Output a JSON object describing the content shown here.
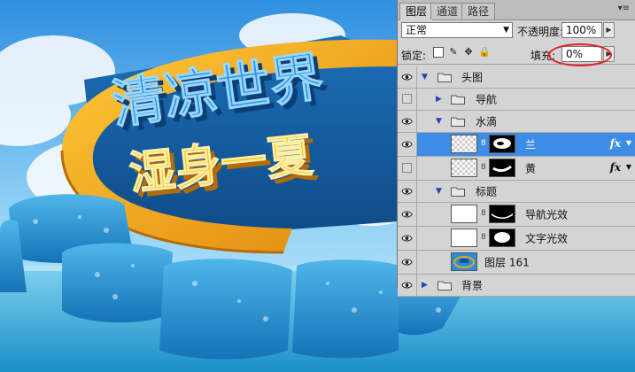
{
  "artwork": {
    "headline_1": "清凉世界",
    "headline_2": "湿身一夏",
    "colors": {
      "sky_top": "#2f8fe0",
      "sky_bottom": "#bfe6fb",
      "sea": "#2aa6d8",
      "title_blue": "#1f7fd0",
      "title_yellow": "#f5b51d",
      "ring_orange": "#f0a21a"
    }
  },
  "panel": {
    "tabs": [
      "图层",
      "通道",
      "路径"
    ],
    "blend_mode": "正常",
    "opacity_label": "不透明度:",
    "opacity_value": "100%",
    "lock_label": "锁定:",
    "fill_label": "填充:",
    "fill_value": "0%",
    "highlight_color": "#e02020"
  },
  "layers": [
    {
      "name": "头图",
      "kind": "group",
      "expanded": true,
      "visible": true
    },
    {
      "name": "导航",
      "kind": "group",
      "expanded": false,
      "visible": false
    },
    {
      "name": "水滴",
      "kind": "group",
      "expanded": true,
      "visible": true
    },
    {
      "name": "兰",
      "kind": "layer",
      "visible": true,
      "selected": true,
      "fx": "fx"
    },
    {
      "name": "黄",
      "kind": "layer",
      "visible": false,
      "fx": "fx"
    },
    {
      "name": "标题",
      "kind": "group",
      "expanded": true,
      "visible": true
    },
    {
      "name": "导航光效",
      "kind": "layer",
      "visible": true
    },
    {
      "name": "文字光效",
      "kind": "layer",
      "visible": true
    },
    {
      "name": "图层 161",
      "kind": "layer",
      "visible": true
    },
    {
      "name": "背景",
      "kind": "group",
      "expanded": false,
      "visible": true
    }
  ]
}
